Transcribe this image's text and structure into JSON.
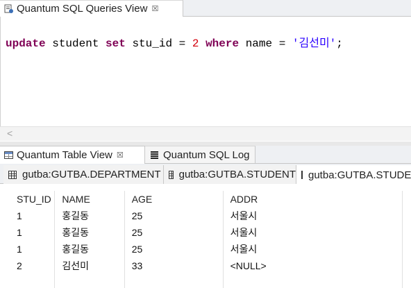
{
  "top_view": {
    "tab_label": "Quantum SQL Queries View",
    "tab_close_glyph": "☒",
    "sql": {
      "t1": "update",
      "t2": " student ",
      "t3": "set",
      "t4": " stu_id = ",
      "t5": "2",
      "t6": " ",
      "t7": "where",
      "t8": " name = ",
      "t9": "'김선미'",
      "t10": ";"
    },
    "scroll_left_glyph": "<"
  },
  "bottom_view": {
    "tabs": [
      {
        "label": "Quantum Table View",
        "close_glyph": "☒",
        "active": true
      },
      {
        "label": "Quantum SQL Log",
        "active": false
      }
    ],
    "subtabs": [
      {
        "label": "gutba:GUTBA.DEPARTMENT",
        "active": false
      },
      {
        "label": "gutba:GUTBA.STUDENT",
        "active": false
      },
      {
        "label": "gutba:GUTBA.STUDENT",
        "active": true
      }
    ],
    "table": {
      "columns": [
        "STU_ID",
        "NAME",
        "AGE",
        "ADDR"
      ],
      "rows": [
        [
          "1",
          "홍길동",
          "25",
          "서울시"
        ],
        [
          "1",
          "홍길동",
          "25",
          "서울시"
        ],
        [
          "1",
          "홍길동",
          "25",
          "서울시"
        ],
        [
          "2",
          "김선미",
          "33",
          "<NULL>"
        ]
      ]
    }
  },
  "colors": {
    "keyword": "#7f0055",
    "number": "#d3010d",
    "string": "#2a00ff"
  },
  "icons": [
    "sql-query-icon",
    "close-icon",
    "table-view-icon",
    "sql-log-icon",
    "table-grid-icon"
  ]
}
